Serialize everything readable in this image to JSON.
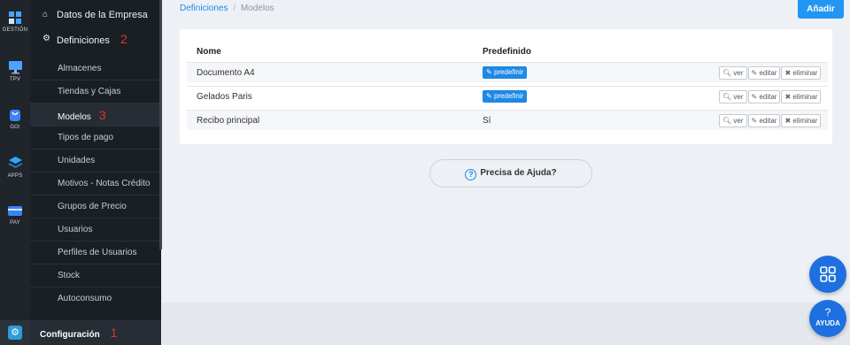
{
  "rail": {
    "items": [
      {
        "label": "GESTIÓN",
        "icon": "dashboard-icon"
      },
      {
        "label": "TPV",
        "icon": "monitor-icon"
      },
      {
        "label": "GO!",
        "icon": "bag-icon"
      },
      {
        "label": "APPS",
        "icon": "layers-icon"
      },
      {
        "label": "PAY",
        "icon": "card-icon"
      }
    ],
    "config_icon": "gear-icon"
  },
  "sidebar": {
    "empresa": "Datos de la Empresa",
    "definiciones": "Definiciones",
    "definiciones_mark": "2",
    "items": [
      "Almacenes",
      "Tiendas y Cajas",
      "Modelos",
      "Tipos de pago",
      "Unidades",
      "Motivos - Notas Crédito",
      "Grupos de Precio",
      "Usuarios",
      "Perfiles de Usuarios",
      "Stock",
      "Autoconsumo"
    ],
    "active_mark": "3",
    "configuracion": "Configuración",
    "configuracion_mark": "1"
  },
  "breadcrumb": {
    "parent": "Definiciones",
    "separator": "/",
    "current": "Modelos"
  },
  "add_button": "Añadir",
  "table": {
    "headers": {
      "name": "Nome",
      "predef": "Predefinido"
    },
    "rows": [
      {
        "name": "Documento A4",
        "predef": "predefinir"
      },
      {
        "name": "Gelados Paris",
        "predef": "predefinir"
      },
      {
        "name": "Recibo principal",
        "predef": "Sí"
      }
    ],
    "actions": {
      "view": "ver",
      "edit": "editar",
      "delete": "eliminar"
    }
  },
  "help_pill": "Precisa de Ajuda?",
  "fab": {
    "help_mark": "?",
    "help_label": "AYUDA"
  },
  "colors": {
    "accent": "#2196f3",
    "sidebar": "#1a1f24",
    "annotation": "#e0322f"
  }
}
